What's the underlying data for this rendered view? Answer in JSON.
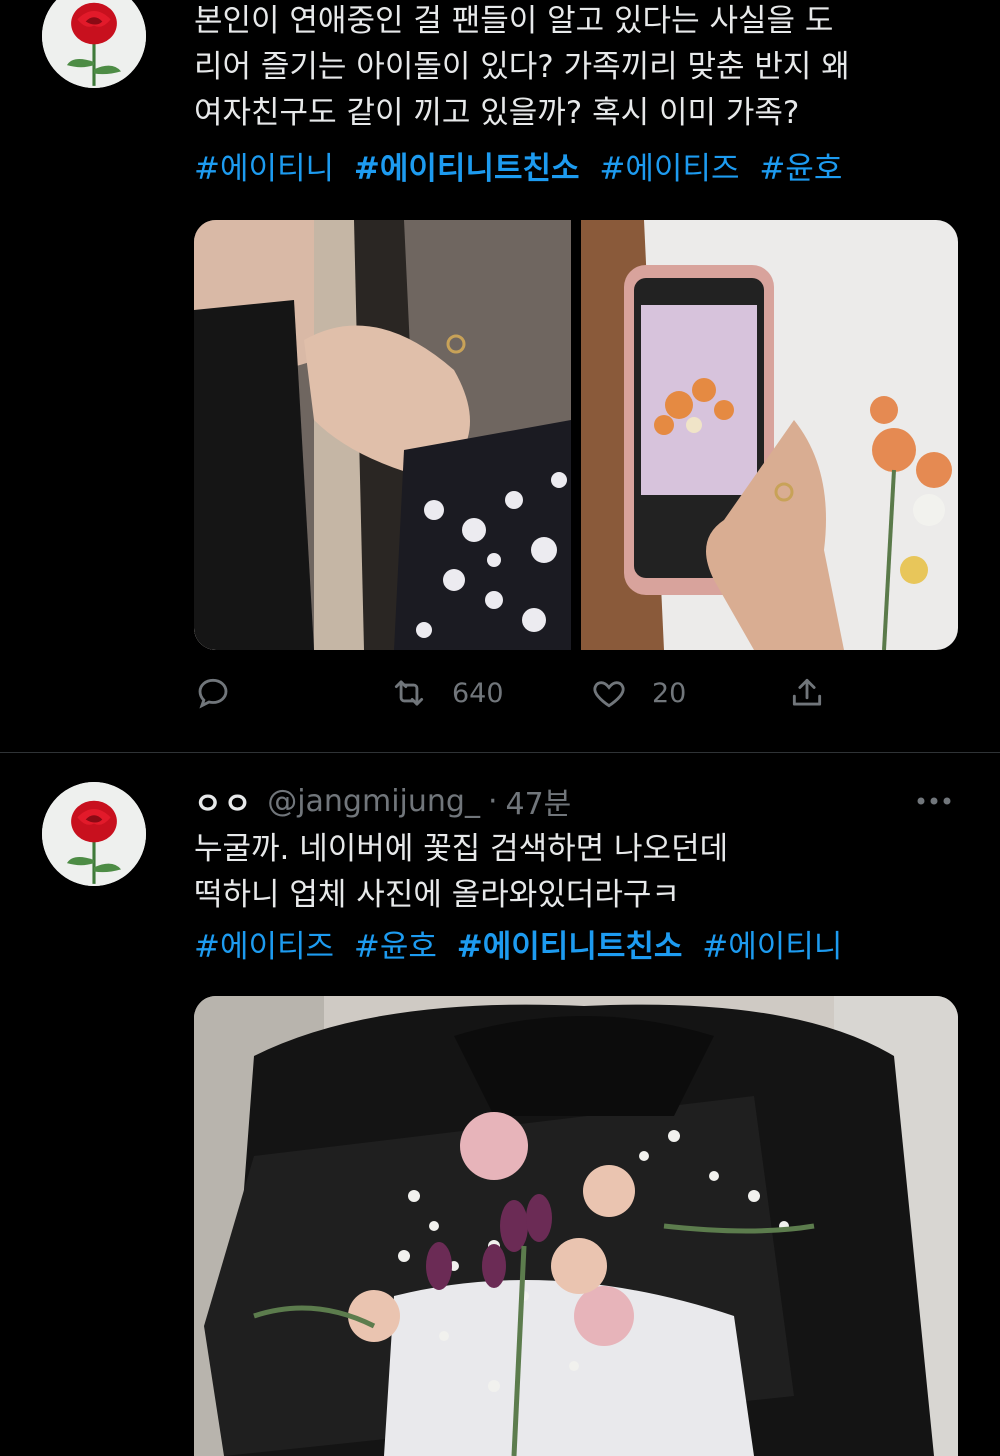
{
  "tweet1": {
    "text_lines": [
      "본인이 연애중인 걸 팬들이 알고 있다는 사실을 도",
      "리어 즐기는 아이돌이 있다? 가족끼리 맞춘 반지 왜",
      "여자친구도 같이 끼고 있을까? 혹시 이미 가족?"
    ],
    "hashtags": [
      "#에이티니",
      "#에이티니트친소",
      "#에이티즈",
      "#윤호"
    ],
    "retweet_count": "640",
    "like_count": "20"
  },
  "tweet2": {
    "display_name": "ㅇㅇ",
    "handle": "@jangmijung_",
    "separator": "·",
    "time": "47분",
    "text_lines": [
      "누굴까. 네이버에 꽃집 검색하면 나오던데",
      "떡하니 업체 사진에 올라와있더라구ㅋ"
    ],
    "hashtags": [
      "#에이티즈",
      "#윤호",
      "#에이티니트친소",
      "#에이티니"
    ]
  },
  "icons": {
    "avatar": "rose-icon",
    "reply": "reply-icon",
    "retweet": "retweet-icon",
    "like": "heart-icon",
    "share": "share-icon",
    "more": "more-icon"
  },
  "colors": {
    "background": "#000000",
    "text": "#e7e9ea",
    "hashtag": "#1d9bf0",
    "muted": "#71767b",
    "divider": "#2f3336"
  }
}
